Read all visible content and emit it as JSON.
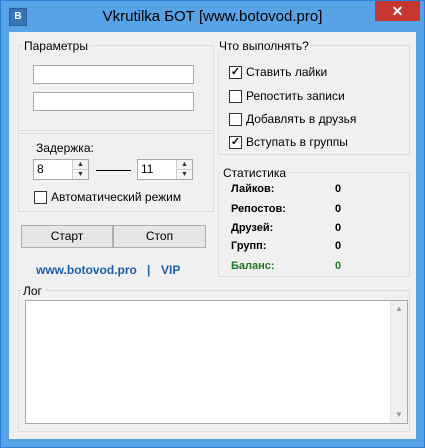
{
  "window": {
    "title": "Vkrutilka БОТ [www.botovod.pro]",
    "icon_letter": "B",
    "close_glyph": "✕"
  },
  "params": {
    "group_title": "Параметры",
    "delay": {
      "label": "Задержка:",
      "from": "8",
      "to": "11"
    },
    "auto_mode_label": "Автоматический режим",
    "start_label": "Старт",
    "stop_label": "Стоп"
  },
  "links": {
    "site": "www.botovod.pro",
    "sep": "|",
    "vip": "VIP"
  },
  "actions": {
    "group_title": "Что выполнять?",
    "likes": "Ставить лайки",
    "repost": "Репостить записи",
    "friends": "Добавлять в друзья",
    "groups": "Вступать в группы"
  },
  "stats": {
    "group_title": "Статистика",
    "likes_label": "Лайков:",
    "likes_value": "0",
    "reposts_label": "Репостов:",
    "reposts_value": "0",
    "friends_label": "Друзей:",
    "friends_value": "0",
    "groups_label": "Групп:",
    "groups_value": "0",
    "balance_label": "Баланс:",
    "balance_value": "0"
  },
  "log": {
    "group_title": "Лог"
  },
  "checks": {
    "mark": "✓"
  }
}
